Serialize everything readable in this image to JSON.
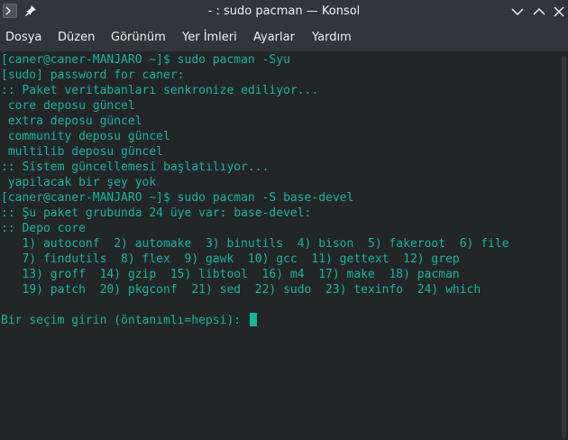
{
  "window": {
    "title": "- : sudo pacman — Konsol",
    "icons": [
      "terminal-app-icon",
      "pin-icon",
      "chevron-down-icon",
      "chevron-up-icon",
      "close-icon"
    ]
  },
  "menu": [
    "Dosya",
    "Düzen",
    "Görünüm",
    "Yer İmleri",
    "Ayarlar",
    "Yardım"
  ],
  "terminal": {
    "lines": [
      "[caner@caner-MANJARO ~]$ sudo pacman -Syu",
      "[sudo] password for caner:",
      ":: Paket veritabanları senkronize ediliyor...",
      " core deposu güncel",
      " extra deposu güncel",
      " community deposu güncel",
      " multilib deposu güncel",
      ":: Sistem güncellemesi başlatılıyor...",
      " yapılacak bir şey yok",
      "[caner@caner-MANJARO ~]$ sudo pacman -S base-devel",
      ":: Şu paket grubunda 24 üye var: base-devel:",
      ":: Depo core",
      "   1) autoconf  2) automake  3) binutils  4) bison  5) fakeroot  6) file",
      "   7) findutils  8) flex  9) gawk  10) gcc  11) gettext  12) grep",
      "   13) groff  14) gzip  15) libtool  16) m4  17) make  18) pacman",
      "   19) patch  20) pkgconf  21) sed  22) sudo  23) texinfo  24) which",
      "",
      "Bir seçim girin (öntanımlı=hepsi): "
    ]
  },
  "colors": {
    "terminal_text": "#18b2a0",
    "terminal_bg": "#232627",
    "chrome_bg": "#31363b"
  }
}
